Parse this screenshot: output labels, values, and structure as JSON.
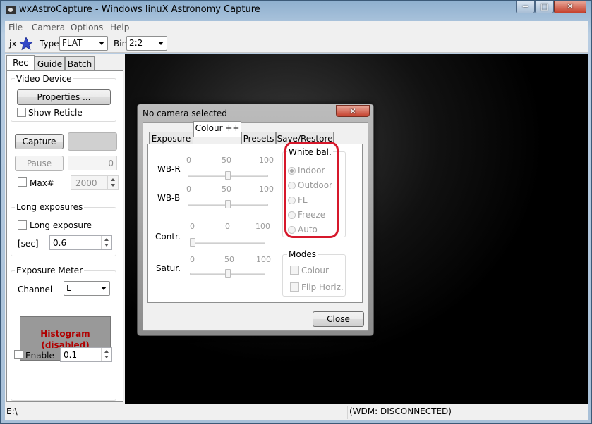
{
  "window": {
    "title": "wxAstroCapture - Windows linuX Astronomy Capture",
    "min_glyph": "−",
    "max_glyph": "□",
    "close_glyph": "✕"
  },
  "menu": [
    "File",
    "Camera",
    "Options",
    "Help"
  ],
  "toolbar": {
    "jx_label": "jx",
    "type_label": "Type",
    "type_value": "FLAT",
    "bin_label": "Bin",
    "bin_value": "2:2"
  },
  "left_tabs": [
    "Rec",
    "Guide",
    "Batch"
  ],
  "video_device": {
    "group_label": "Video Device",
    "properties_button": "Properties ...",
    "show_reticle": "Show Reticle"
  },
  "capture": {
    "capture_button": "Capture",
    "pause_button": "Pause",
    "pause_value": "0",
    "max_label": "Max#",
    "max_value": "2000"
  },
  "long_exposures": {
    "group_label": "Long exposures",
    "checkbox_label": "Long exposure",
    "sec_label": "[sec]",
    "sec_value": "0.6"
  },
  "exposure_meter": {
    "group_label": "Exposure Meter",
    "channel_label": "Channel",
    "channel_value": "L",
    "histogram_line1": "Histogram",
    "histogram_line2": "(disabled)",
    "enable_label": "Enable",
    "enable_value": "0.1"
  },
  "status": {
    "path": "E:\\",
    "connection": "(WDM: DISCONNECTED)"
  },
  "dialog": {
    "title": "No camera selected",
    "tabs": [
      "Exposure",
      "Colour ++",
      "Presets",
      "Save/Restore"
    ],
    "sliders": {
      "wbr": {
        "label": "WB-R",
        "min": "0",
        "mid": "50",
        "max": "100",
        "value": 50
      },
      "wbb": {
        "label": "WB-B",
        "min": "0",
        "mid": "50",
        "max": "100",
        "value": 50
      },
      "contr": {
        "label": "Contr.",
        "min": "0",
        "mid": "0",
        "max": "100",
        "value": 0
      },
      "satur": {
        "label": "Satur.",
        "min": "0",
        "mid": "50",
        "max": "100",
        "value": 50
      }
    },
    "white_balance": {
      "group_label": "White bal.",
      "options": [
        "Indoor",
        "Outdoor",
        "FL",
        "Freeze",
        "Auto"
      ],
      "selected": "Indoor"
    },
    "modes": {
      "group_label": "Modes",
      "colour": "Colour",
      "flip": "Flip Horiz."
    },
    "close_button": "Close"
  },
  "colors": {
    "highlight": "#d6182b",
    "histogram_text": "#b00000",
    "histogram_bg": "#999999"
  }
}
